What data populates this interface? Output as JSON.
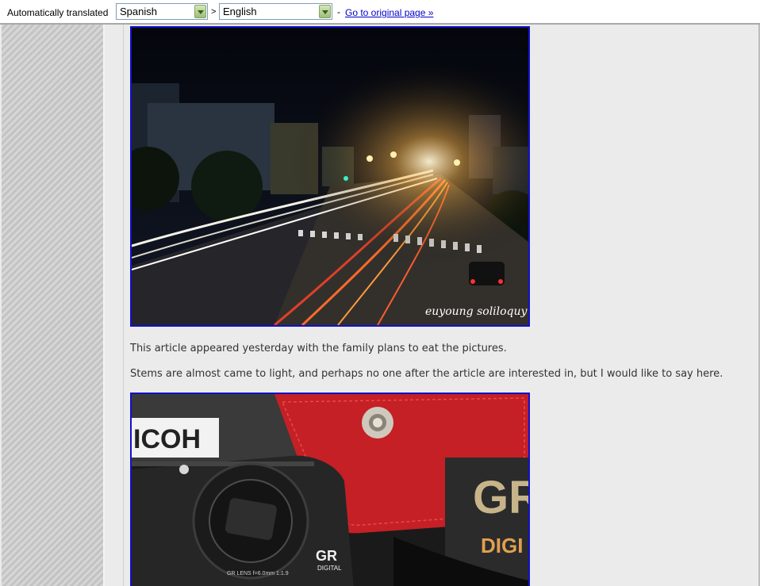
{
  "translate_bar": {
    "label": "Automatically translated",
    "from_language": "Spanish",
    "separator": ">",
    "to_language": "English",
    "dash": "-",
    "original_link": "Go to original page »"
  },
  "article": {
    "photo1": {
      "watermark": "euyoung soliloquy"
    },
    "paragraph1": "This article appeared yesterday with the family plans to eat the pictures.",
    "paragraph2": "Stems are almost came to light, and perhaps no one after the article are interested in, but I would like to say here.",
    "photo2": {
      "brand_text": "ICOH",
      "model_text": "GR",
      "model_subtext": "DIGITAL",
      "lens_text": "GR LENS f=6.0mm 1:1.9",
      "box_text": "DIGI"
    }
  },
  "colors": {
    "link": "#0000cc",
    "photo_border": "#1010cc",
    "page_bg": "#ebebeb"
  }
}
